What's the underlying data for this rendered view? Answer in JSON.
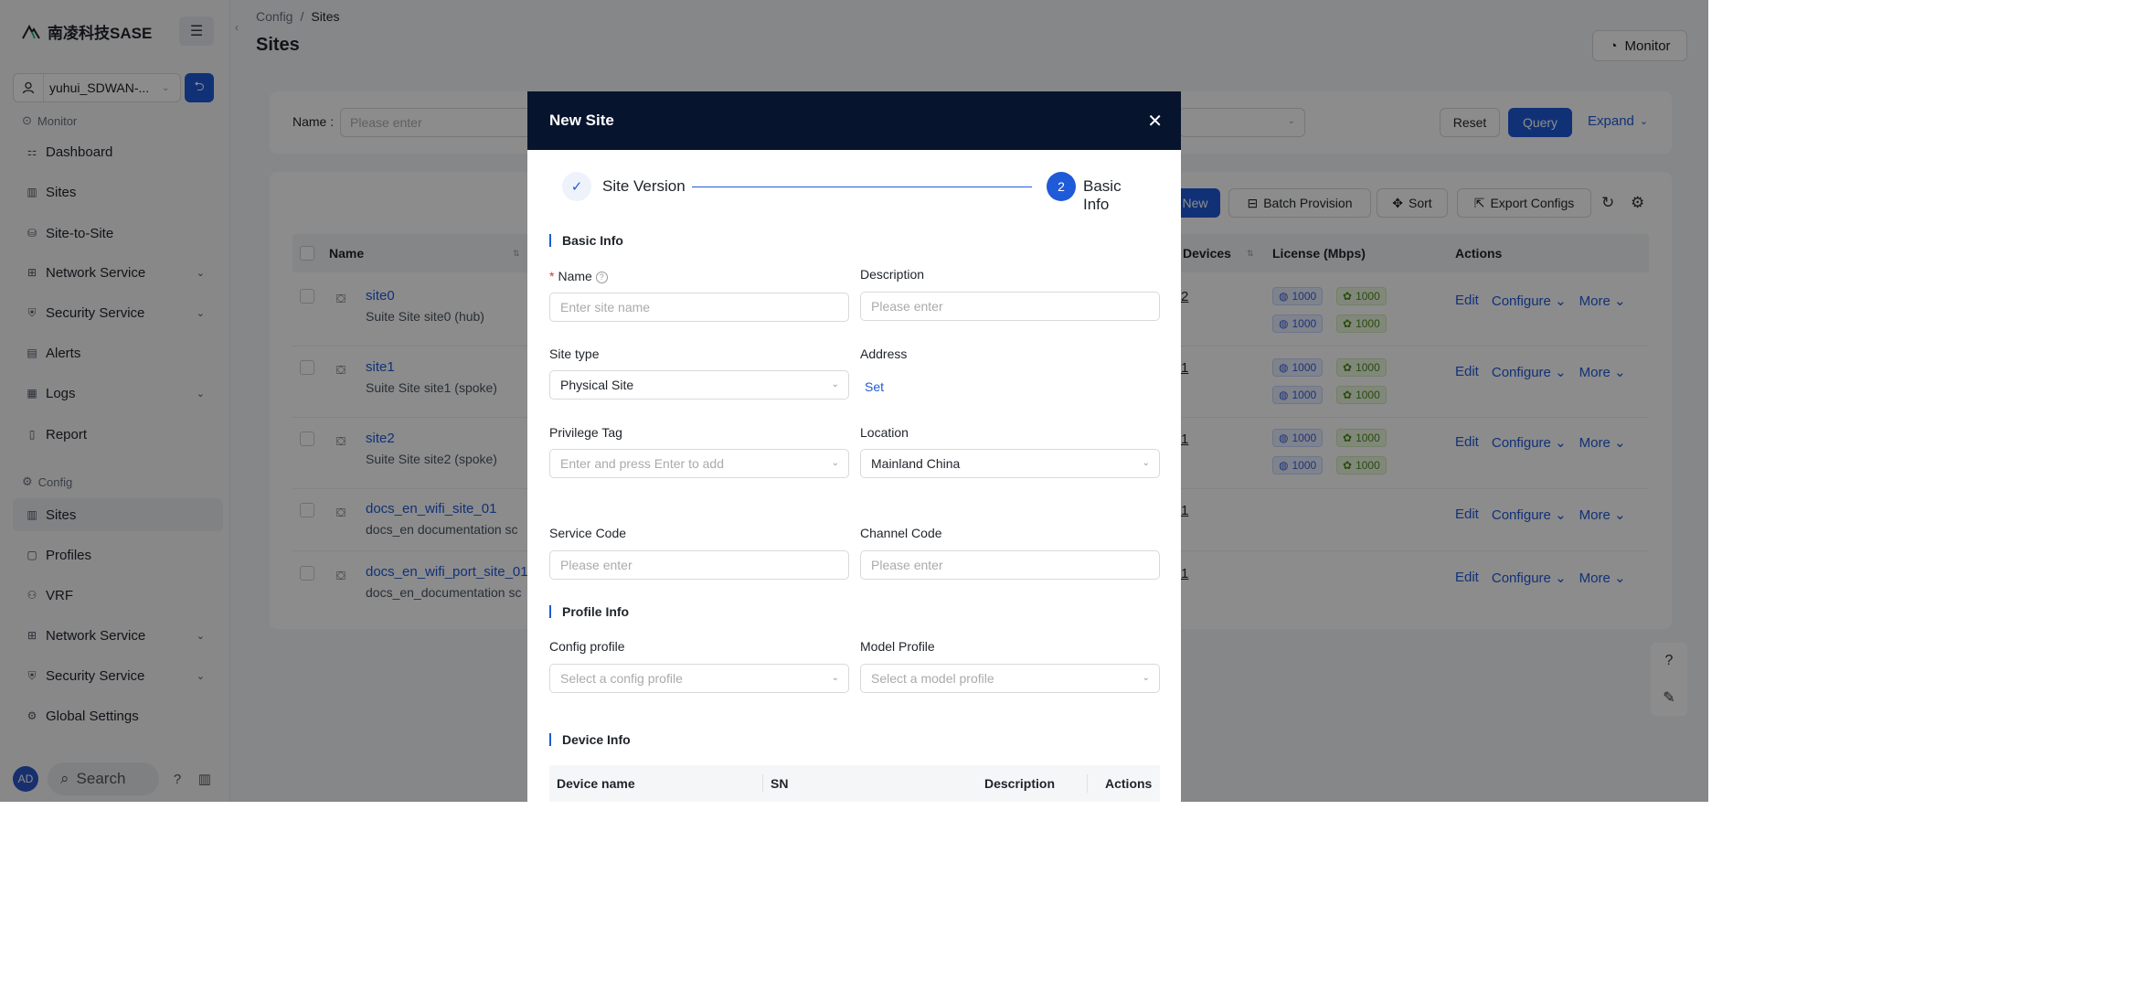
{
  "sidebar": {
    "brand": "南凌科技SASE",
    "tenant": "yuhui_SDWAN-...",
    "monitor_section": "Monitor",
    "monitor_items": [
      "Dashboard",
      "Sites",
      "Site-to-Site",
      "Network Service",
      "Security Service",
      "Alerts",
      "Logs",
      "Report"
    ],
    "config_section": "Config",
    "config_items": [
      "Sites",
      "Profiles",
      "VRF",
      "Network Service",
      "Security Service",
      "Global Settings"
    ],
    "avatar": "AD",
    "search": "Search"
  },
  "header": {
    "breadcrumb": [
      "Config",
      "/",
      "Sites"
    ],
    "title": "Sites",
    "monitor_button": "Monitor"
  },
  "filter": {
    "name_label": "Name",
    "name_placeholder": "Please enter",
    "reset": "Reset",
    "query": "Query",
    "expand": "Expand"
  },
  "toolbar": {
    "new": "New",
    "batch_provision": "Batch Provision",
    "sort": "Sort",
    "export": "Export Configs"
  },
  "table": {
    "columns": [
      "Name",
      "Devices",
      "License (Mbps)",
      "Actions"
    ],
    "rows": [
      {
        "name": "site0",
        "desc": "Suite Site site0 (hub)",
        "devices": "2",
        "lic": [
          "1000",
          "1000",
          "1000",
          "1000"
        ]
      },
      {
        "name": "site1",
        "desc": "Suite Site site1 (spoke)",
        "devices": "1",
        "lic": [
          "1000",
          "1000",
          "1000",
          "1000"
        ]
      },
      {
        "name": "site2",
        "desc": "Suite Site site2 (spoke)",
        "devices": "1",
        "lic": [
          "1000",
          "1000",
          "1000",
          "1000"
        ]
      },
      {
        "name": "docs_en_wifi_site_01",
        "desc": "docs_en documentation sc",
        "devices": "1",
        "lic": []
      },
      {
        "name": "docs_en_wifi_port_site_01",
        "desc": "docs_en_documentation sc",
        "devices": "1",
        "lic": []
      }
    ],
    "actions": {
      "edit": "Edit",
      "configure": "Configure",
      "more": "More"
    }
  },
  "modal": {
    "title": "New Site",
    "step1": "Site Version",
    "step2_num": "2",
    "step2": "Basic Info",
    "basic_info": "Basic Info",
    "name_label": "Name",
    "name_placeholder": "Enter site name",
    "description_label": "Description",
    "description_placeholder": "Please enter",
    "site_type_label": "Site type",
    "site_type_value": "Physical Site",
    "address_label": "Address",
    "address_link": "Set",
    "privilege_tag_label": "Privilege Tag",
    "privilege_tag_placeholder": "Enter and press Enter to add",
    "location_label": "Location",
    "location_value": "Mainland China",
    "service_code_label": "Service Code",
    "service_code_placeholder": "Please enter",
    "channel_code_label": "Channel Code",
    "channel_code_placeholder": "Please enter",
    "profile_info": "Profile Info",
    "config_profile_label": "Config profile",
    "config_profile_placeholder": "Select a config profile",
    "model_profile_label": "Model Profile",
    "model_profile_placeholder": "Select a model profile",
    "device_info": "Device Info",
    "device_columns": [
      "Device name",
      "SN",
      "Description",
      "Actions"
    ]
  },
  "colors": {
    "accent": "#1f5ad9",
    "modal_header": "#06142e"
  }
}
